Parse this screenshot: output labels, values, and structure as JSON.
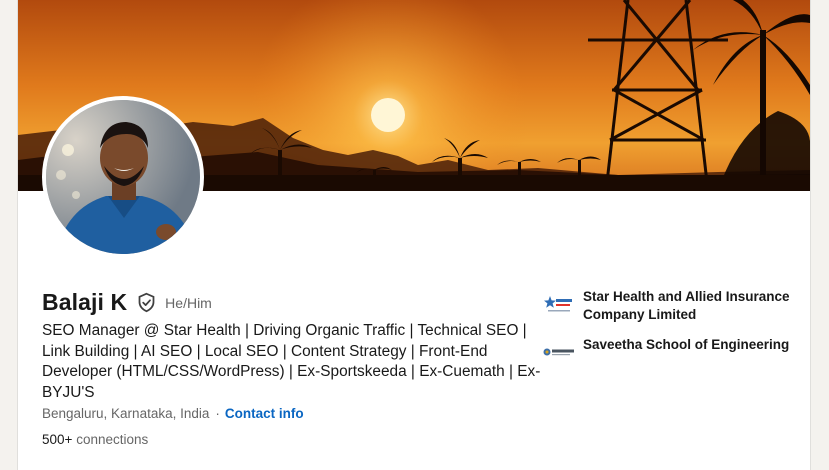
{
  "profile": {
    "name": "Balaji K",
    "pronouns": "He/Him",
    "headline": "SEO Manager @ Star Health | Driving Organic Traffic | Technical SEO | Link Building | AI SEO | Local SEO | Content Strategy | Front-End Developer (HTML/CSS/WordPress) | Ex-Sportskeeda | Ex-Cuemath | Ex-BYJU'S",
    "location": "Bengaluru, Karnataka, India",
    "location_separator": "·",
    "contact_label": "Contact info",
    "connections_count": "500+",
    "connections_label": "connections"
  },
  "organizations": [
    {
      "name": "Star Health and Allied Insurance Company Limited",
      "logo_icon": "star-health-logo"
    },
    {
      "name": "Saveetha School of Engineering",
      "logo_icon": "simats-logo"
    }
  ],
  "icons": {
    "verified": "verified-shield-icon"
  },
  "colors": {
    "link": "#0a66c2",
    "muted": "#666666",
    "text": "#191919"
  }
}
